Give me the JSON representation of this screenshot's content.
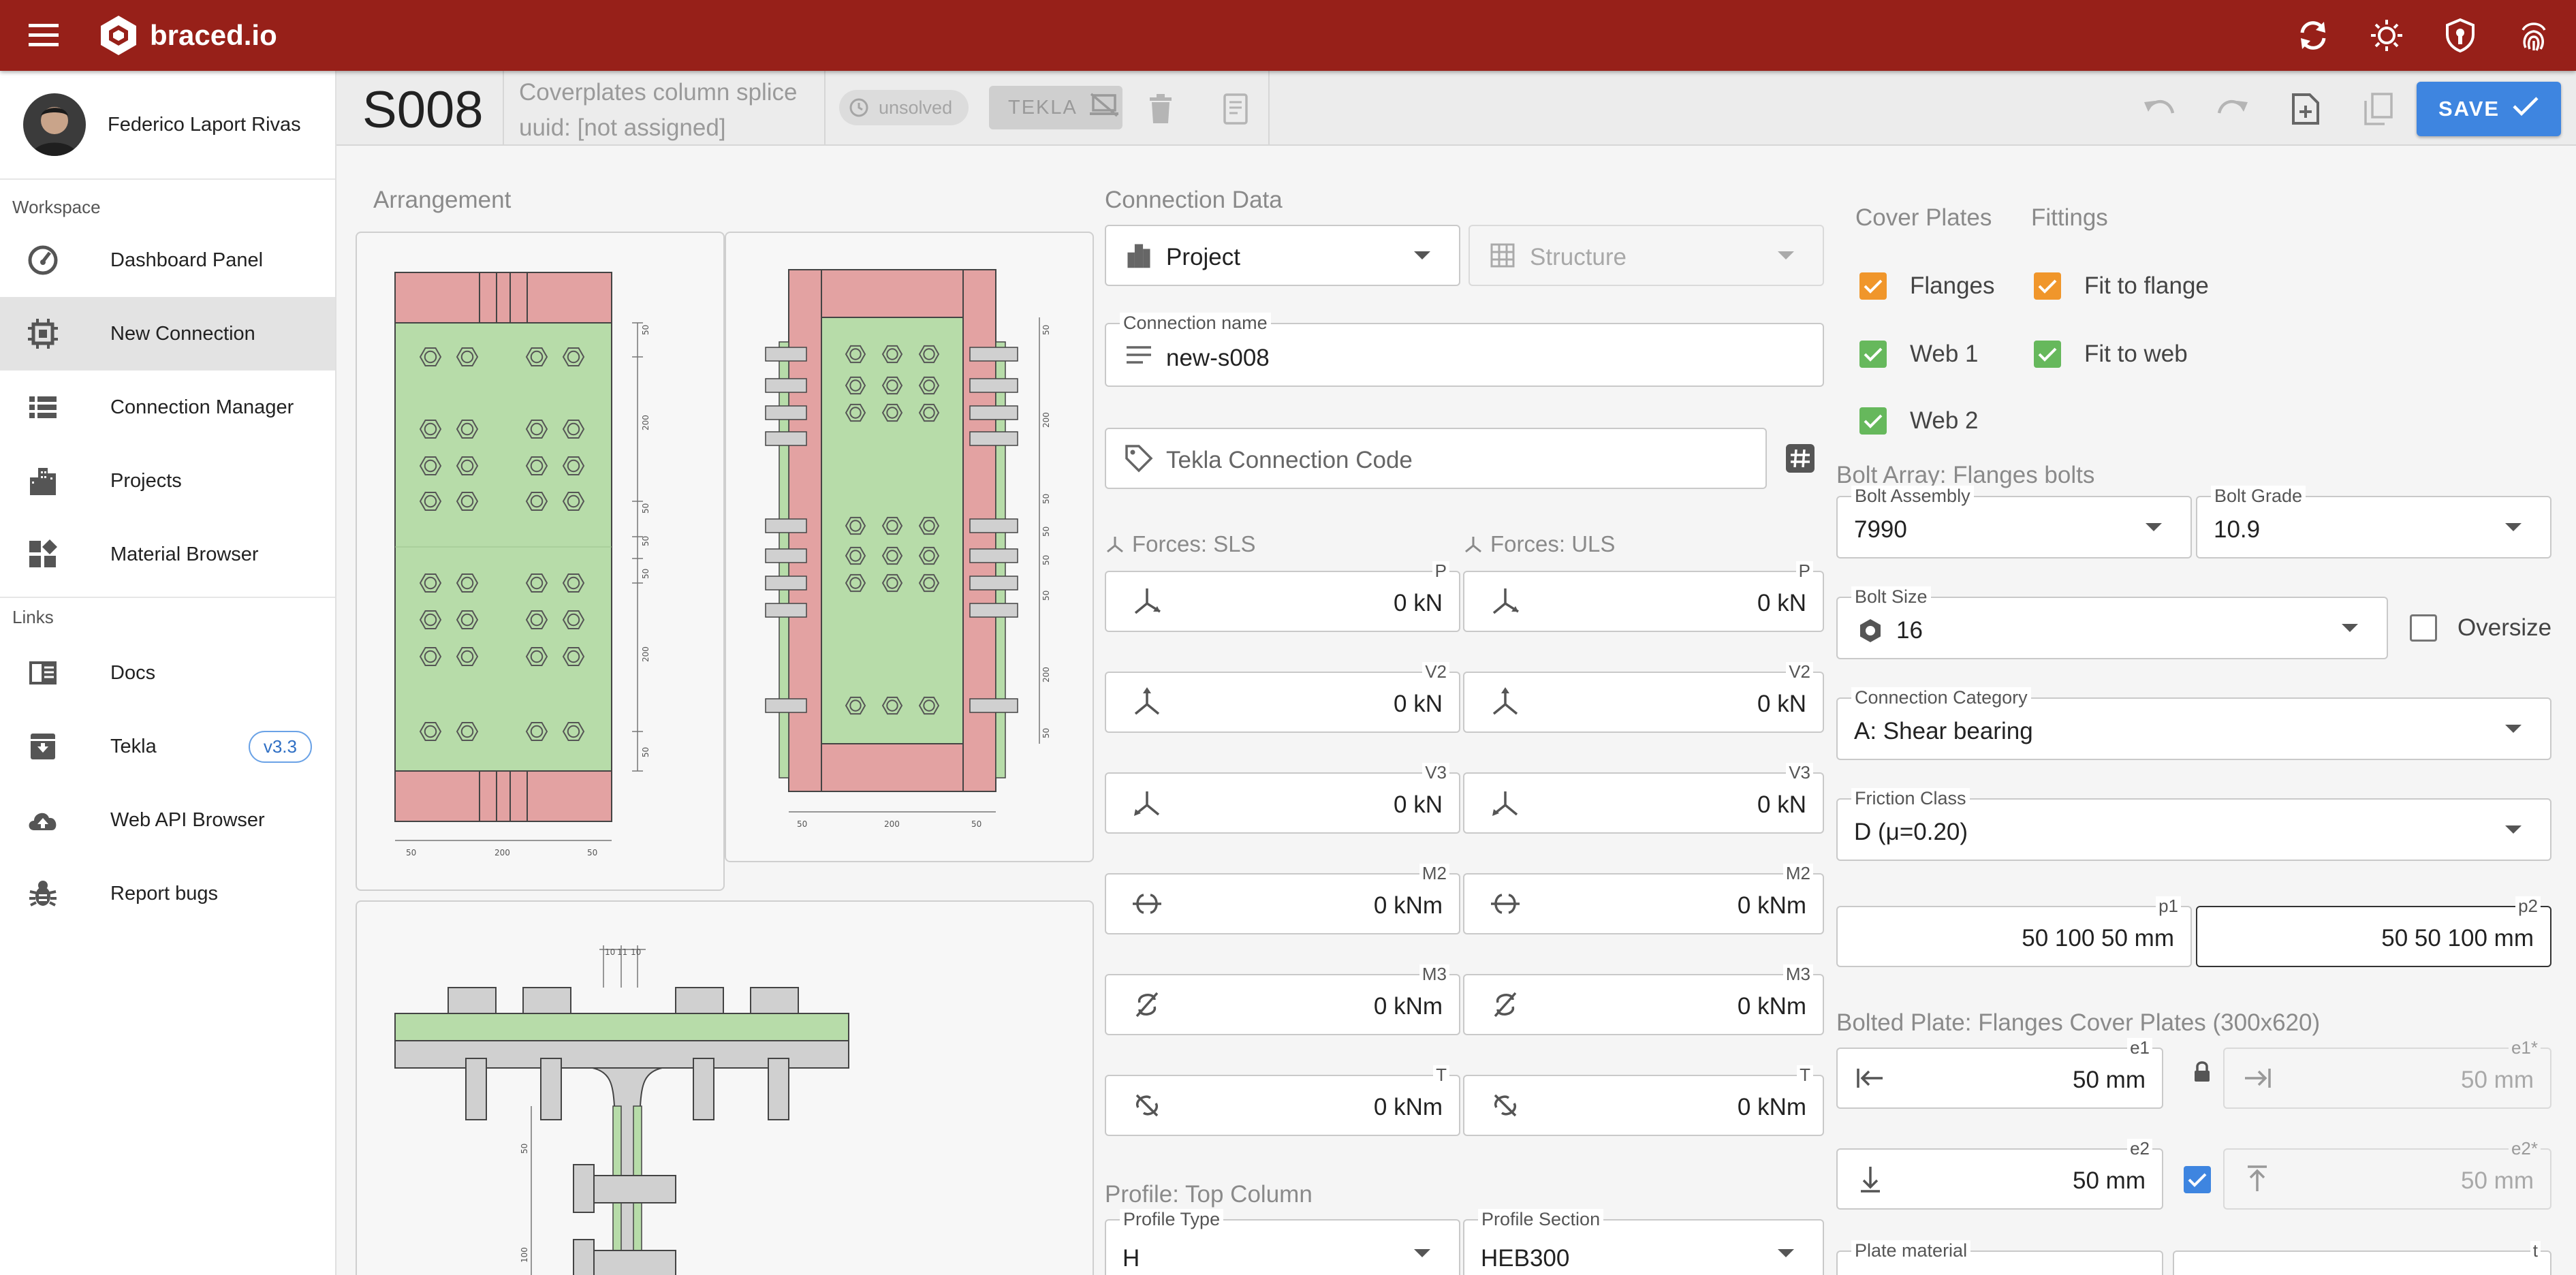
{
  "app": {
    "name": "braced.io"
  },
  "user": {
    "name": "Federico Laport Rivas"
  },
  "sidebar": {
    "workspace_caption": "Workspace",
    "links_caption": "Links",
    "workspace_items": [
      {
        "label": "Dashboard Panel",
        "icon": "speedometer-icon"
      },
      {
        "label": "New Connection",
        "icon": "chip-icon"
      },
      {
        "label": "Connection Manager",
        "icon": "list-icon"
      },
      {
        "label": "Projects",
        "icon": "city-icon"
      },
      {
        "label": "Material Browser",
        "icon": "widgets-icon"
      }
    ],
    "link_items": [
      {
        "label": "Docs",
        "icon": "book-icon"
      },
      {
        "label": "Tekla",
        "icon": "archive-icon",
        "badge": "v3.3"
      },
      {
        "label": "Web API Browser",
        "icon": "cloud-icon"
      },
      {
        "label": "Report bugs",
        "icon": "bug-icon"
      }
    ]
  },
  "header": {
    "connection_id": "S008",
    "description": "Coverplates column splice",
    "uuid": "uuid: [not assigned]",
    "status": "unsolved",
    "tekla_label": "TEKLA",
    "save_label": "SAVE"
  },
  "arrangement": {
    "title": "Arrangement"
  },
  "connection_data": {
    "title": "Connection Data",
    "project_select": "Project",
    "structure_select": "Structure",
    "name_label": "Connection name",
    "name_value": "new-s008",
    "tekla_code_placeholder": "Tekla Connection Code",
    "forces_sls_title": "Forces: SLS",
    "forces_uls_title": "Forces: ULS",
    "forces": [
      {
        "label": "P",
        "sls": "0 kN",
        "uls": "0 kN",
        "icon": "axial-force-icon"
      },
      {
        "label": "V2",
        "sls": "0 kN",
        "uls": "0 kN",
        "icon": "shear-v2-icon"
      },
      {
        "label": "V3",
        "sls": "0 kN",
        "uls": "0 kN",
        "icon": "shear-v3-icon"
      },
      {
        "label": "M2",
        "sls": "0 kNm",
        "uls": "0 kNm",
        "icon": "moment-m2-icon"
      },
      {
        "label": "M3",
        "sls": "0 kNm",
        "uls": "0 kNm",
        "icon": "moment-m3-icon"
      },
      {
        "label": "T",
        "sls": "0 kNm",
        "uls": "0 kNm",
        "icon": "torsion-icon"
      }
    ],
    "profile_title": "Profile: Top Column",
    "profile_type_label": "Profile Type",
    "profile_type_value": "H",
    "profile_section_label": "Profile Section",
    "profile_section_value": "HEB300"
  },
  "cover_plates": {
    "title": "Cover Plates",
    "flanges": "Flanges",
    "web1": "Web 1",
    "web2": "Web 2"
  },
  "fittings": {
    "title": "Fittings",
    "fit_to_flange": "Fit to flange",
    "fit_to_web": "Fit to web"
  },
  "bolt_array": {
    "title": "Bolt Array: Flanges bolts",
    "assembly_label": "Bolt Assembly",
    "assembly_value": "7990",
    "grade_label": "Bolt Grade",
    "grade_value": "10.9",
    "size_label": "Bolt Size",
    "size_value": "16",
    "oversize_label": "Oversize",
    "category_label": "Connection Category",
    "category_value": "A: Shear bearing",
    "friction_label": "Friction Class",
    "friction_value": "D (μ=0.20)",
    "p1_label": "p1",
    "p1_value": "50 100 50 mm",
    "p2_label": "p2",
    "p2_value": "50 50 100 mm"
  },
  "bolted_plate": {
    "title": "Bolted Plate: Flanges Cover Plates (300x620)",
    "e1_label": "e1",
    "e1_value": "50 mm",
    "e1s_label": "e1*",
    "e1s_value": "50 mm",
    "e2_label": "e2",
    "e2_value": "50 mm",
    "e2s_label": "e2*",
    "e2s_value": "50 mm",
    "material_label": "Plate material",
    "t_label": "t"
  },
  "drawing": {
    "dims_front_vertical": [
      "50",
      "200",
      "50",
      "50",
      "50",
      "200",
      "50"
    ],
    "dims_front_horizontal": [
      "50",
      "200",
      "50"
    ],
    "dims_side_vertical": [
      "50",
      "200",
      "50",
      "50",
      "50",
      "50",
      "200",
      "50"
    ],
    "dims_side_horizontal": [
      "50",
      "200",
      "50"
    ],
    "dims_top": [
      "10",
      "11",
      "10"
    ],
    "dims_section": [
      "50",
      "100"
    ]
  }
}
